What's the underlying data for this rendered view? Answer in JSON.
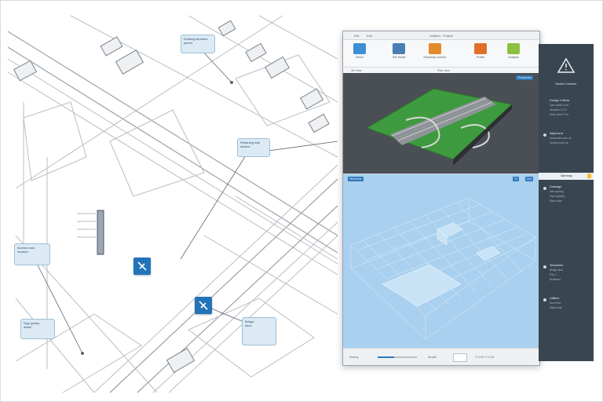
{
  "window": {
    "title": "Untitled - Project",
    "menu": [
      "File",
      "Edit"
    ],
    "ribbon": [
      {
        "label": "Select",
        "color": "#3b8fd4"
      },
      {
        "label": "Site Model",
        "color": "#4a7fb4"
      },
      {
        "label": "Roadway Corridor",
        "color": "#e38b2b"
      },
      {
        "label": "Profile",
        "color": "#e06f2a"
      },
      {
        "label": "Analysis",
        "color": "#8dc13f"
      }
    ],
    "info_left": "3D View",
    "info_right": "Plan View"
  },
  "viewports": {
    "top_label": "Perspective",
    "bottom_label": "Wireframe",
    "bottom_buttons": [
      "Fit",
      "Grid"
    ]
  },
  "statusbar": {
    "left": "Ready",
    "zoom_percent": 42,
    "mode": "Model",
    "coords": "X 0.00  Y 0.00"
  },
  "sidepanel": {
    "title": "Model Checker",
    "sections": [
      {
        "title": "Design Criteria",
        "lines": [
          "Lane width 3.6 m",
          "Shoulder 2.4 m",
          "Clear zone 9.0 m"
        ]
      },
      {
        "title": "Alignment",
        "lines": [
          "Horizontal curve ok",
          "Vertical curve ok"
        ]
      },
      {
        "title": "Drainage",
        "lines": [
          "Inlet spacing",
          "Pipe capacity",
          "Ditch slope"
        ]
      },
      {
        "title": "Structures",
        "lines": [
          "Bridge deck",
          "Pier 1",
          "Abutment"
        ]
      },
      {
        "title": "Utilities",
        "lines": [
          "Storm line",
          "Water main"
        ]
      }
    ],
    "highlight": "Warnings"
  },
  "callouts": [
    {
      "lines": [
        "Existing structure",
        "parcel"
      ]
    },
    {
      "lines": [
        "Retaining wall",
        "section"
      ]
    },
    {
      "lines": [
        "Access road",
        "revision"
      ]
    },
    {
      "lines": [
        "Sign gantry",
        "detail"
      ]
    },
    {
      "lines": [
        "Bridge",
        "deck"
      ]
    }
  ],
  "colors": {
    "accent": "#2273b8",
    "viewport_dark": "#4a4f55",
    "viewport_blue": "#a9d0ee",
    "panel_dark": "#39454f"
  }
}
